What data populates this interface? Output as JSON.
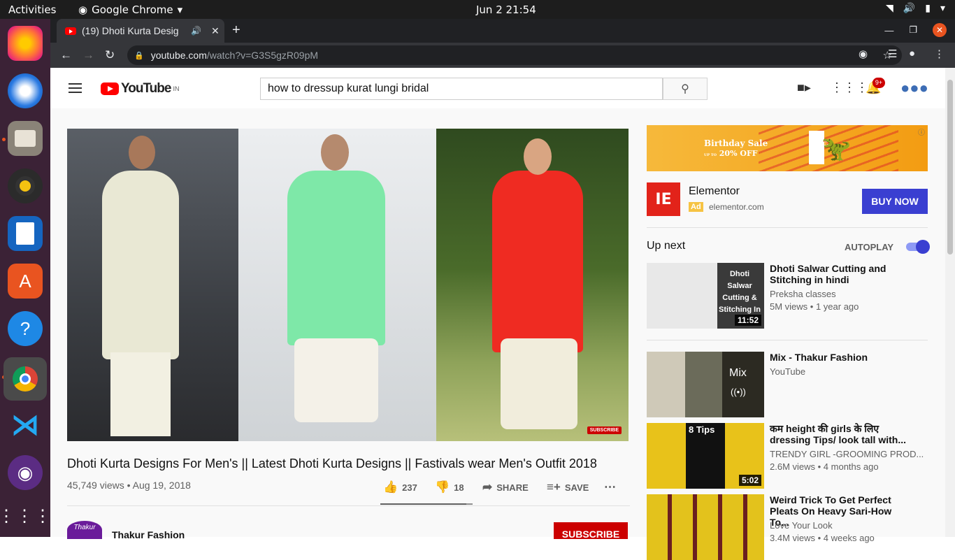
{
  "system": {
    "activities": "Activities",
    "app": "Google Chrome",
    "clock": "Jun 2  21:54"
  },
  "dock": [
    "firefox-icon",
    "thunderbird-icon",
    "files-icon",
    "rhythmbox-icon",
    "writer-icon",
    "software-icon",
    "help-icon",
    "chrome-icon",
    "vscode-icon",
    "podcast-icon",
    "apps-grid-icon"
  ],
  "browser": {
    "tab_title": "(19) Dhoti Kurta Desig",
    "url_host": "youtube.com",
    "url_path": "/watch?v=G3S5gzR09pM"
  },
  "youtube": {
    "logo_text": "YouTube",
    "logo_region": "IN",
    "search_value": "how to dressup kurat lungi bridal",
    "notif_count": "9+",
    "video": {
      "title": "Dhoti Kurta Designs For Men's || Latest Dhoti Kurta Designs || Fastivals wear Men's Outfit 2018",
      "views": "45,749 views • Aug 19, 2018",
      "likes": "237",
      "dislikes": "18",
      "share": "SHARE",
      "save": "SAVE",
      "like_ratio": 0.93,
      "watermark": "SUBSCRIBE"
    },
    "channel": {
      "name": "Thakur Fashion",
      "avatar_text": "Thakur",
      "subscribe": "SUBSCRIBE"
    },
    "ad": {
      "banner_line1": "Birthday Sale",
      "banner_line2": "20% OFF",
      "banner_line2_prefix": "UP TO",
      "name": "Elementor",
      "badge": "Ad",
      "url": "elementor.com",
      "button": "BUY NOW",
      "logo": "IE"
    },
    "upnext": "Up next",
    "autoplay": "AUTOPLAY",
    "recs": [
      {
        "title": "Dhoti Salwar Cutting and Stitching in hindi",
        "channel": "Preksha classes",
        "meta": "5M views • 1 year ago",
        "duration": "11:52",
        "thumb_text": "Dhoti Salwar Cutting & Stitching In"
      },
      {
        "title": "Mix - Thakur Fashion",
        "channel": "YouTube",
        "meta": "",
        "duration": "",
        "thumb_text": "Mix"
      },
      {
        "title": "कम height की girls के लिए dressing Tips/ look tall with...",
        "channel": "TRENDY GIRL -GROOMING PROD...",
        "meta": "2.6M views • 4 months ago",
        "duration": "5:02",
        "thumb_text": "8 Tips"
      },
      {
        "title": "Weird Trick To Get Perfect Pleats On Heavy Sari-How To...",
        "channel": "Love Your Look",
        "meta": "3.4M views • 4 weeks ago",
        "duration": "",
        "thumb_text": ""
      }
    ]
  }
}
